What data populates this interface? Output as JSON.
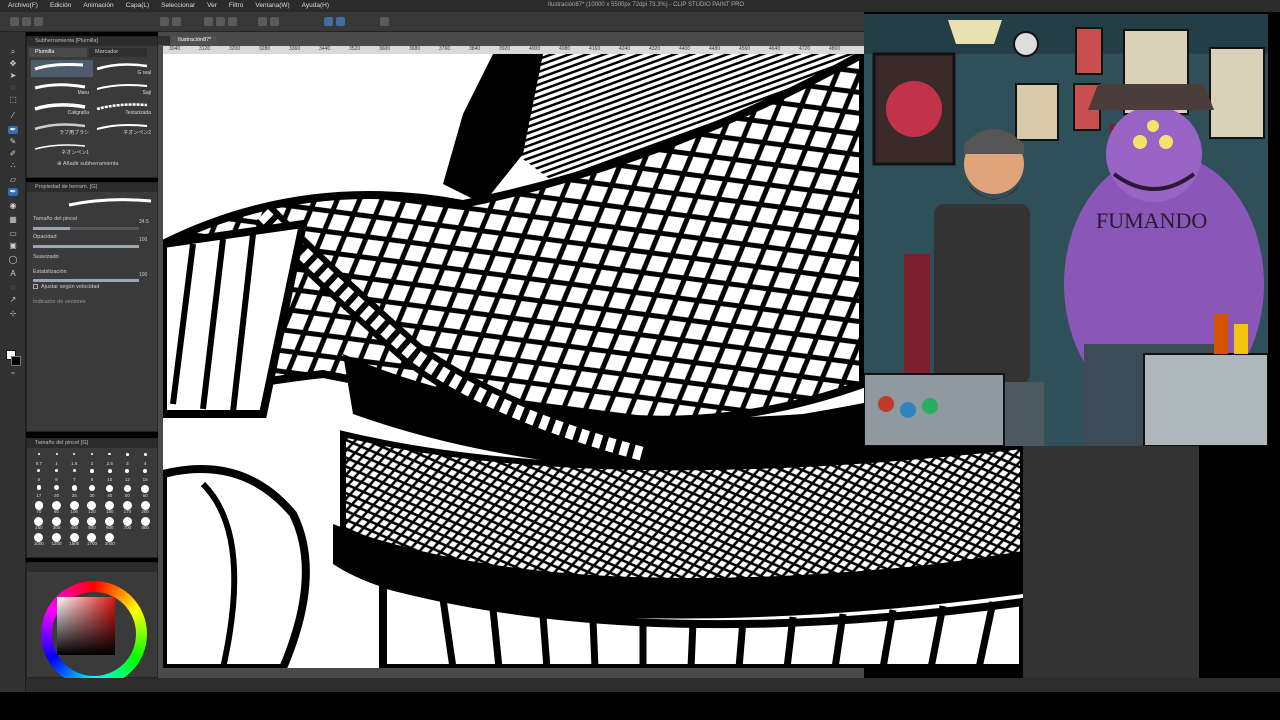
{
  "window": {
    "title": "Ilustración87* (10000 x 5500px 72dpi 73.3%) - CLIP STUDIO PAINT PRO"
  },
  "menu": [
    "Archivo(F)",
    "Edición",
    "Animación",
    "Capa(L)",
    "Seleccionar",
    "Ver",
    "Filtro",
    "Ventana(W)",
    "Ayuda(H)"
  ],
  "document_tabs": [
    "",
    "Ilustración87*"
  ],
  "ruler_ticks": [
    "3040",
    "3120",
    "3200",
    "3280",
    "3360",
    "3440",
    "3520",
    "3600",
    "3680",
    "3760",
    "3840",
    "3920",
    "4000",
    "4080",
    "4160",
    "4240",
    "4320",
    "4400",
    "4480",
    "4560",
    "4640",
    "4720",
    "4800"
  ],
  "subtool_panel": {
    "header": "Subherramienta [Plumilla]",
    "tabs": [
      "Plumilla",
      "Marcador"
    ],
    "brushes": [
      "",
      "G real",
      "Maru",
      "Saji",
      "Caligrafía",
      "Texturizada",
      "ラフ用ブラシ",
      "ネオンペン2",
      "ネオンペン1",
      ""
    ],
    "add_label": "Añadir subherramienta"
  },
  "tool_property": {
    "header": "Propiedad de herram. [G]",
    "brush_size_label": "Tamaño del pincel",
    "brush_size_value": "34.5",
    "opacity_label": "Opacidad",
    "opacity_value": "100",
    "antialiasing_label": "Suavizado",
    "stabilization_label": "Estabilización",
    "stabilization_value": "100",
    "velocity_label": "Ajustar según velocidad",
    "vector_label": "Indicador de vectores"
  },
  "brush_size_panel": {
    "header": "Tamaño del pincel [G]",
    "sizes": [
      "0.7",
      "1",
      "1.5",
      "2",
      "2.5",
      "3",
      "4",
      "5",
      "6",
      "7",
      "8",
      "10",
      "12",
      "15",
      "17",
      "20",
      "25",
      "30",
      "40",
      "50",
      "60",
      "70",
      "80",
      "100",
      "120",
      "150",
      "170",
      "200",
      "250",
      "300",
      "400",
      "500",
      "600",
      "700",
      "800",
      "1000",
      "1200",
      "1500",
      "1700",
      "2000"
    ]
  },
  "color_panel": {
    "fg": "#ffffff",
    "bg": "#000000",
    "hue_color": "#e01616"
  },
  "reference": {
    "text": "FUMANDO"
  }
}
